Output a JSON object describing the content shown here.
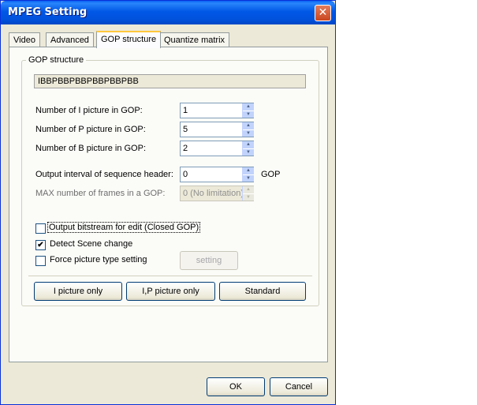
{
  "window": {
    "title": "MPEG Setting",
    "close_glyph": "✕"
  },
  "tabs": [
    {
      "label": "Video",
      "active": false
    },
    {
      "label": "Advanced",
      "active": false
    },
    {
      "label": "GOP structure",
      "active": true
    },
    {
      "label": "Quantize matrix",
      "active": false
    }
  ],
  "gop": {
    "group_label": "GOP structure",
    "pattern": "IBBPBBPBBPBBPBBPBB",
    "fields": [
      {
        "label": "Number of I picture in GOP:",
        "value": "1",
        "enabled": true
      },
      {
        "label": "Number of P picture in GOP:",
        "value": "5",
        "enabled": true
      },
      {
        "label": "Number of B picture in GOP:",
        "value": "2",
        "enabled": true
      },
      {
        "label": "Output interval of sequence header:",
        "value": "0",
        "enabled": true,
        "unit": "GOP"
      },
      {
        "label": "MAX number of frames in a GOP:",
        "value": "0 (No limitation)",
        "enabled": false
      }
    ],
    "checkboxes": [
      {
        "label": "Output bitstream for edit (Closed GOP)",
        "checked": false
      },
      {
        "label": "Detect Scene change",
        "checked": true
      },
      {
        "label": "Force picture type setting",
        "checked": false
      }
    ],
    "setting_button": "setting",
    "preset_buttons": {
      "i_only": "I picture only",
      "ip_only": "I,P picture only",
      "standard": "Standard"
    }
  },
  "footer": {
    "ok": "OK",
    "cancel": "Cancel"
  }
}
